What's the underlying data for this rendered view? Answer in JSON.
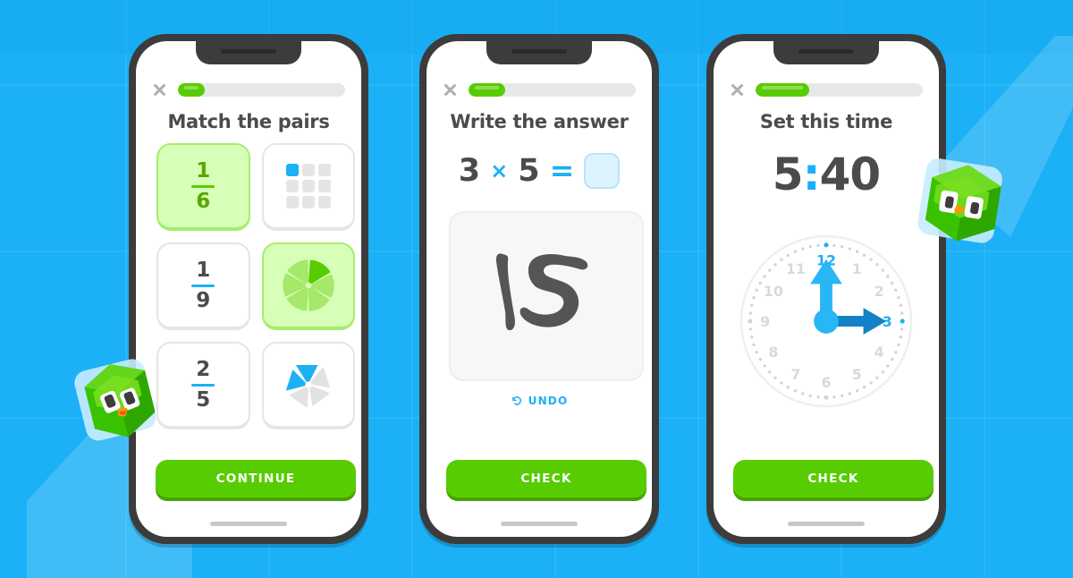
{
  "theme": {
    "bg_blue": "#1cb0f6",
    "brand_green": "#58cc02",
    "green_dark": "#46a302",
    "text_gray": "#4b4b4b",
    "accent_blue": "#1cb0f6",
    "light_green_fill": "#d7ffb8"
  },
  "screens": [
    {
      "id": "match-the-pairs",
      "close_icon": "close-icon",
      "progress_percent": 16,
      "title": "Match the pairs",
      "cards": [
        {
          "type": "fraction",
          "numerator": "1",
          "denominator": "6",
          "selected": true,
          "icon": "fraction-one-sixth"
        },
        {
          "type": "grid",
          "icon": "grid-3x3-icon",
          "total": 9,
          "filled": 1,
          "selected": false
        },
        {
          "type": "fraction",
          "numerator": "1",
          "denominator": "9",
          "selected": false,
          "icon": "fraction-one-ninth"
        },
        {
          "type": "pie",
          "icon": "pie-six-slice-icon",
          "total": 6,
          "filled": 1,
          "selected": true
        },
        {
          "type": "fraction",
          "numerator": "2",
          "denominator": "5",
          "selected": false,
          "icon": "fraction-two-fifths"
        },
        {
          "type": "pentagon",
          "icon": "pentagon-five-slice-icon",
          "total": 5,
          "filled": 2,
          "selected": false
        }
      ],
      "cta_label": "CONTINUE"
    },
    {
      "id": "write-the-answer",
      "close_icon": "close-icon",
      "progress_percent": 22,
      "title": "Write the answer",
      "equation": {
        "left": "3",
        "operator": "×",
        "right": "5",
        "equals": "=",
        "answer": ""
      },
      "handwriting_value": "15",
      "undo_icon": "undo-arrow-icon",
      "undo_label": "UNDO",
      "cta_label": "CHECK"
    },
    {
      "id": "set-this-time",
      "close_icon": "close-icon",
      "progress_percent": 32,
      "title": "Set this time",
      "time": {
        "hours": "5",
        "separator": ":",
        "minutes": "40"
      },
      "clock": {
        "highlight_numbers": [
          "12",
          "3"
        ],
        "numbers": [
          "12",
          "1",
          "2",
          "3",
          "4",
          "5",
          "6",
          "7",
          "8",
          "9",
          "10",
          "11"
        ],
        "hour_hand_points_to": "12",
        "minute_hand_points_to": "3"
      },
      "cta_label": "CHECK"
    }
  ],
  "mascots": [
    {
      "name": "duo-cube-mascot-left",
      "color": "#58cc02"
    },
    {
      "name": "duo-cube-mascot-right",
      "color": "#58cc02"
    }
  ]
}
